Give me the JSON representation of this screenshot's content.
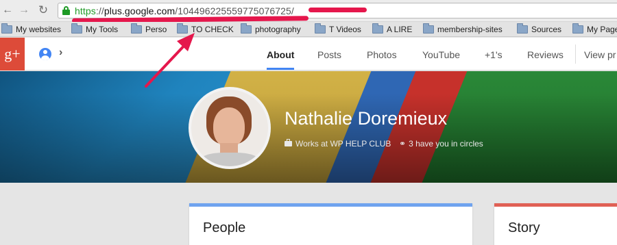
{
  "browser": {
    "url": {
      "scheme": "https",
      "separator": "://",
      "host": "plus.google.com",
      "path": "/104496225559775076725/"
    },
    "annotation_color": "#e5174c"
  },
  "bookmarks": [
    {
      "label": "My websites"
    },
    {
      "label": "My Tools"
    },
    {
      "label": "Perso"
    },
    {
      "label": "TO CHECK"
    },
    {
      "label": "photography"
    },
    {
      "label": "T Videos"
    },
    {
      "label": "A LIRE"
    },
    {
      "label": "membership-sites"
    },
    {
      "label": "Sources"
    },
    {
      "label": "My Page"
    }
  ],
  "gplus": {
    "logo": "g+",
    "brand_color": "#dd4b39",
    "tabs": [
      {
        "label": "About",
        "active": true
      },
      {
        "label": "Posts"
      },
      {
        "label": "Photos"
      },
      {
        "label": "YouTube"
      },
      {
        "label": "+1's"
      },
      {
        "label": "Reviews"
      },
      {
        "label": "View pr"
      }
    ]
  },
  "profile": {
    "name": "Nathalie Doremieux",
    "work": "Works at WP HELP CLUB",
    "circles": "3 have you in circles"
  },
  "cards": [
    {
      "title": "People",
      "accent": "#6fa3ef"
    },
    {
      "title": "Story",
      "accent": "#e06055"
    }
  ]
}
